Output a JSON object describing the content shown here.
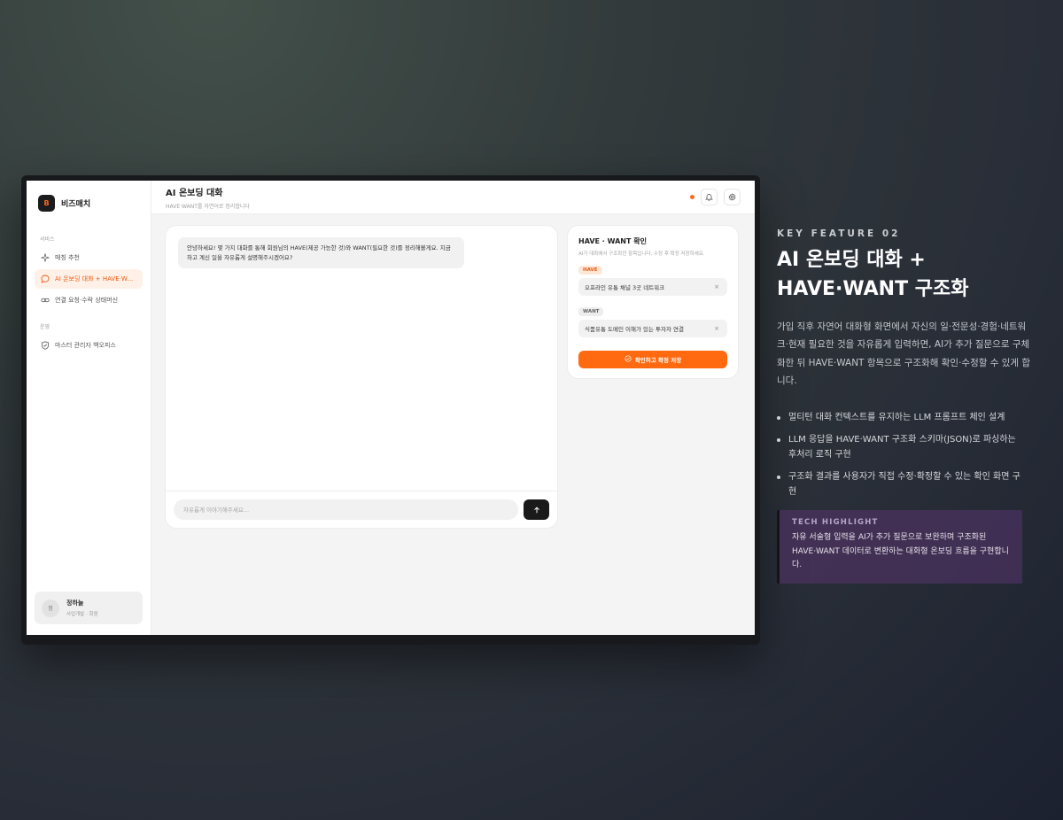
{
  "app": {
    "brand_initial": "B",
    "brand_name": "비즈매치"
  },
  "sidebar": {
    "section_service": "서비스",
    "section_ops": "운영",
    "items": [
      {
        "label": "매칭 추천",
        "icon": "sparkle-icon"
      },
      {
        "label": "AI 온보딩 대화 + HAVE·WANT 구조화",
        "icon": "chat-bubble-icon"
      },
      {
        "label": "연결 요청·수락 상태머신",
        "icon": "link-icon"
      },
      {
        "label": "마스터 관리자 백오피스",
        "icon": "shield-icon"
      }
    ],
    "user": {
      "initial": "정",
      "name": "정하늘",
      "role": "사업개발 · 회원"
    }
  },
  "topbar": {
    "title": "AI 온보딩 대화",
    "subtitle": "HAVE·WANT를 자연어로 정리합니다"
  },
  "chat": {
    "ai_message": "안녕하세요! 몇 가지 대화를 통해 회원님의 HAVE(제공 가능한 것)와 WANT(필요한 것)를 정리해볼게요. 지금 하고 계신 일을 자유롭게 설명해주시겠어요?",
    "input_placeholder": "자유롭게 이야기해주세요..."
  },
  "haveWant": {
    "title": "HAVE · WANT 확인",
    "subtitle": "AI가 대화에서 구조화한 항목입니다. 수정 후 확정 저장하세요.",
    "have_tag": "HAVE",
    "have_value": "오프라인 유통 채널 3곳 네트워크",
    "want_tag": "WANT",
    "want_value": "식품유통 도메인 이해가 있는 투자자 연결",
    "remove_symbol": "×",
    "confirm_label": "확인하고 확정 저장"
  },
  "feature": {
    "kicker": "KEY FEATURE 02",
    "title_line1": "AI 온보딩 대화 +",
    "title_line2": "HAVE·WANT 구조화",
    "description": "가입 직후 자연어 대화형 화면에서 자신의 일·전문성·경험·네트워크·현재 필요한 것을 자유롭게 입력하면, AI가 추가 질문으로 구체화한 뒤 HAVE·WANT 항목으로 구조화해 확인·수정할 수 있게 합니다.",
    "bullets": [
      "멀티턴 대화 컨텍스트를 유지하는 LLM 프롬프트 체인 설계",
      "LLM 응답을 HAVE·WANT 구조화 스키마(JSON)로 파싱하는 후처리 로직 구현",
      "구조화 결과를 사용자가 직접 수정·확정할 수 있는 확인 화면 구현"
    ],
    "highlight_title": "TECH HIGHLIGHT",
    "highlight_text": "자유 서술형 입력을 AI가 추가 질문으로 보완하며 구조화된 HAVE·WANT 데이터로 변환하는 대화형 온보딩 흐름을 구현합니다."
  },
  "colors": {
    "accent": "#ff6a10",
    "dark": "#1a1a1a"
  }
}
